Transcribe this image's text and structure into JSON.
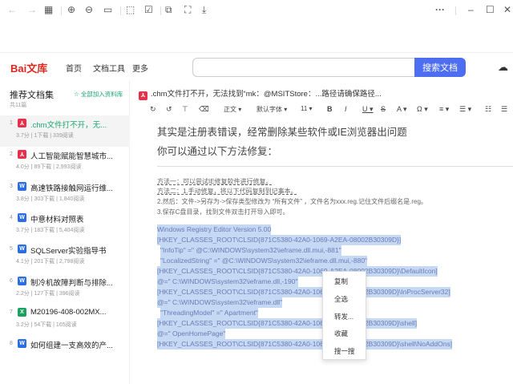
{
  "toolbar": {
    "icons": [
      "back-icon",
      "forward-icon",
      "grid-icon",
      "zoom-in-icon",
      "zoom-out-icon",
      "actual-size-icon",
      "rotate-icon",
      "edit-icon",
      "copy-icon",
      "screenshot-icon",
      "download-icon"
    ],
    "more": "···",
    "minimize": "–",
    "maximize": "☐",
    "close": "✕"
  },
  "header": {
    "logo": "Bai文库",
    "nav": [
      "首页",
      "文档工具",
      "更多"
    ],
    "search_placeholder": "",
    "search_button": "搜索文档"
  },
  "sidebar": {
    "title": "推荐文档集",
    "add_all": "全部加入资料库",
    "count": "共11篇",
    "items": [
      {
        "num": "1",
        "type": "pdf",
        "title": ".chm文件打不开，无...",
        "meta": "3.7分 | 1下载 | 339阅读"
      },
      {
        "num": "2",
        "type": "pdf",
        "title": "人工智能赋能智慧城市...",
        "meta": "4.0分 | 89下载 | 2,993阅读"
      },
      {
        "num": "3",
        "type": "word",
        "title": "高速铁路接触网运行维...",
        "meta": "3.8分 | 303下载 | 1,840阅读"
      },
      {
        "num": "4",
        "type": "word",
        "title": "中意材料对照表",
        "meta": "3.7分 | 183下载 | 5,404阅读"
      },
      {
        "num": "5",
        "type": "word",
        "title": "SQLServer实验指导书",
        "meta": "4.1分 | 201下载 | 2,798阅读"
      },
      {
        "num": "6",
        "type": "word",
        "title": "制冷机故障判断与排除...",
        "meta": "2.2分 | 127下载 | 396阅读"
      },
      {
        "num": "7",
        "type": "excel",
        "title": "M20196-408-002MX...",
        "meta": "3.2分 | 54下载 | 165阅读"
      },
      {
        "num": "8",
        "type": "word",
        "title": "如何组建一支高效的产...",
        "meta": ""
      }
    ]
  },
  "document": {
    "title": ".chm文件打不开，无法找到“mk：@MSITStore：...路径请确保路径...",
    "format": {
      "style": "正文 ▾",
      "font": "默认字体 ▾",
      "size": "11 ▾",
      "bold": "B",
      "italic": "I",
      "underline": "U ▾",
      "strike": "S",
      "color": "A ▾",
      "highlight": "Ω ▾",
      "align": "≡ ▾",
      "spacing": "☰ ▾",
      "list1": "☷",
      "list2": "☰"
    },
    "heading1": "其实是注册表错误，经常删除某些软件或IE浏览器出问题",
    "heading2": "你可以通过以下方法修复：",
    "steps": [
      "方法一：可以尝试IE修复软件进行修复。",
      "方法二：1.手动修复，将以下代码复制到记事本。",
      "2.然后：文件->另存为->保存类型修改为 “所有文件” ，文件名为xxx.reg.记住文件后缀名是.reg。",
      "3.保存C盘目录，找到文件双击打开导入即可。"
    ],
    "registry": [
      "Windows Registry Editor Version 5.00",
      "[HKEY_CLASSES_ROOT\\CLSID{871C5380-42A0-1069-A2EA-08002B30309D}]",
      "\"InfoTip\" =\" @C:\\WINDOWS\\system32\\ieframe.dll.mui,-881\"",
      "\"LocalizedString\" =\" @C:\\WINDOWS\\system32\\ieframe.dll.mui,-880\"",
      "[HKEY_CLASSES_ROOT\\CLSID{871C5380-42A0-1069-A2EA-08002B30309D}\\DefaultIcon]",
      "@=\" C:\\WINDOWS\\system32\\ieframe.dll,-190\"",
      "[HKEY_CLASSES_ROOT\\CLSID{871C5380-42A0-1069-A2EA-08002B30309D}\\InProcServer32]",
      "@=\" C:\\WINDOWS\\system32\\ieframe.dll\"",
      "\"ThreadingModel\" =\" Apartment\"",
      "[HKEY_CLASSES_ROOT\\CLSID{871C5380-42A0-1069-A2EA-08002B30309D}\\shell]",
      "@=\" OpenHomePage\"",
      "[HKEY_CLASSES_ROOT\\CLSID{871C5380-42A0-1069-A2EA-08002B30309D}\\shell\\NoAddOns]"
    ]
  },
  "context_menu": [
    "复制",
    "全选",
    "转发...",
    "收藏",
    "搜一搜"
  ],
  "colors": {
    "accent": "#4e6ef2",
    "green": "#1ba672",
    "pdf": "#e8304a",
    "word": "#2b6de5",
    "excel": "#1aa260",
    "selection": "#c5d9f5"
  }
}
